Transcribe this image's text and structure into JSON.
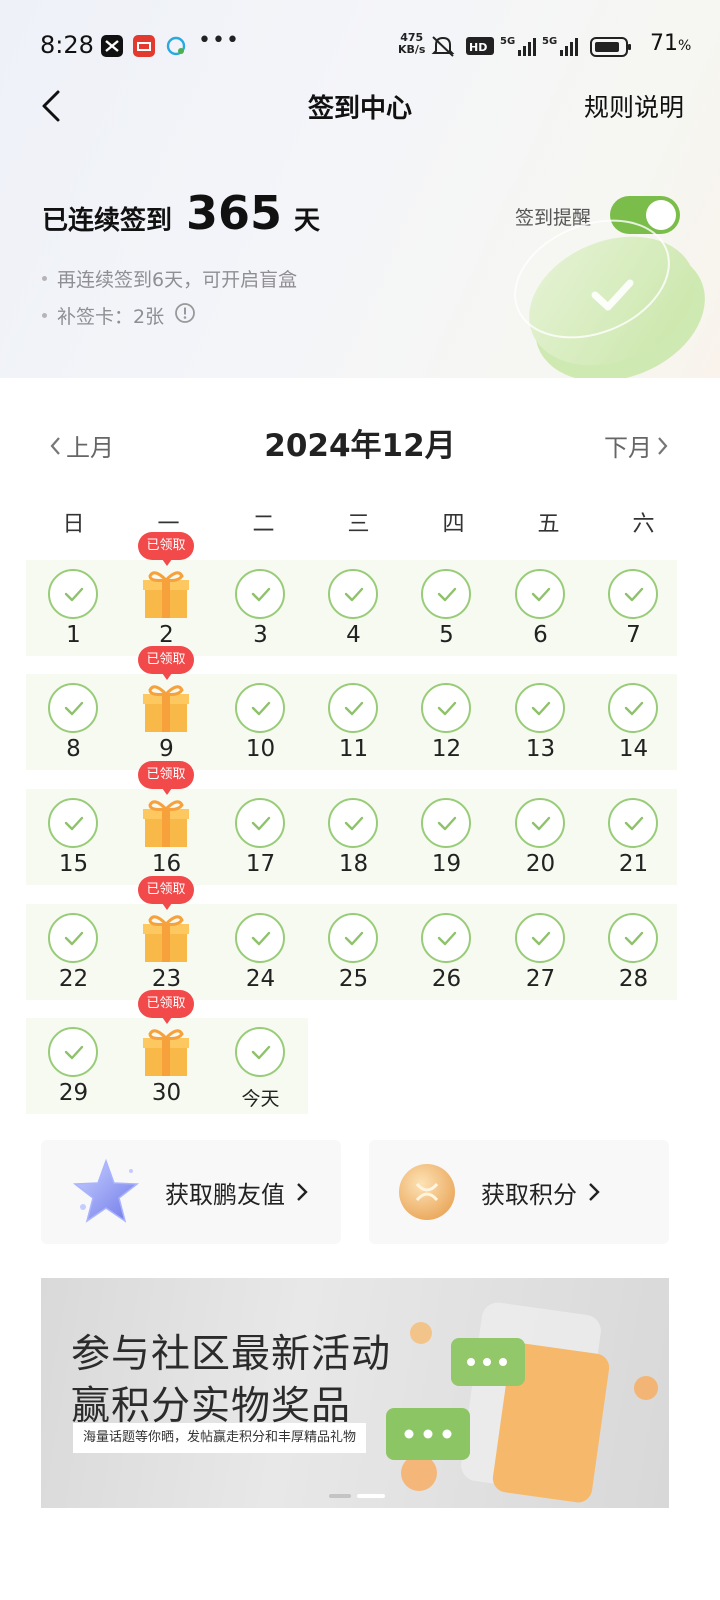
{
  "status_bar": {
    "time": "8:28",
    "speed_value": "475",
    "speed_unit": "KB/s",
    "battery": "71",
    "battery_unit": "%"
  },
  "nav": {
    "title": "签到中心",
    "rules": "规则说明"
  },
  "streak": {
    "prefix": "已连续签到",
    "days": "365",
    "suffix": "天",
    "tip_blindbox": "再连续签到6天，可开启盲盒",
    "tip_makeup": "补签卡：2张",
    "reminder_label": "签到提醒",
    "reminder_on": true
  },
  "calendar": {
    "prev": "上月",
    "next": "下月",
    "month": "2024年12月",
    "weekdays": [
      "日",
      "一",
      "二",
      "三",
      "四",
      "五",
      "六"
    ],
    "claimed_label": "已领取",
    "today_label": "今天",
    "weeks": [
      [
        "1",
        "2",
        "3",
        "4",
        "5",
        "6",
        "7"
      ],
      [
        "8",
        "9",
        "10",
        "11",
        "12",
        "13",
        "14"
      ],
      [
        "15",
        "16",
        "17",
        "18",
        "19",
        "20",
        "21"
      ],
      [
        "22",
        "23",
        "24",
        "25",
        "26",
        "27",
        "28"
      ],
      [
        "29",
        "30",
        "今天"
      ]
    ]
  },
  "cards": {
    "friend_value": "获取鹏友值",
    "points": "获取积分"
  },
  "banner": {
    "line1": "参与社区最新活动",
    "line2": "赢积分实物奖品",
    "subtitle": "海量话题等你晒，发帖赢走积分和丰厚精品礼物"
  },
  "colors": {
    "accent_green": "#7bbd4a",
    "check_green": "#99cc79",
    "badge_red": "#f24a4a",
    "row_bg": "#f6faf0"
  }
}
